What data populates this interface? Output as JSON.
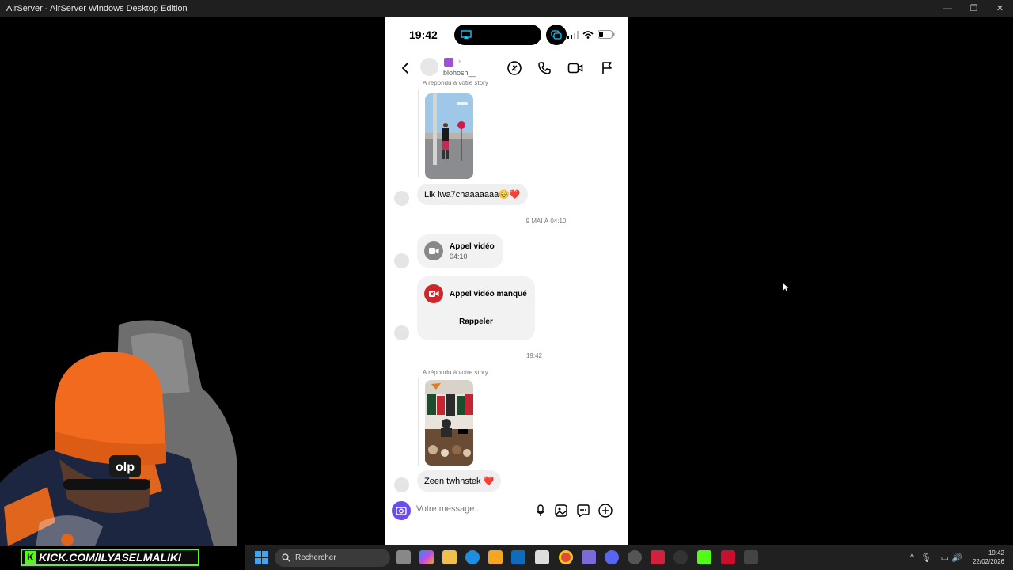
{
  "window": {
    "title": "AirServer - AirServer Windows Desktop Edition"
  },
  "phone": {
    "status": {
      "time": "19:42"
    },
    "header": {
      "username": "blohosh__"
    },
    "messages": {
      "top_partial_label": "A répondu à votre story",
      "reply1_text": "Lik lwa7chaaaaaaa🥺❤️",
      "timestamp1": "9 MAI À 04:10",
      "call1_title": "Appel vidéo",
      "call1_time": "04:10",
      "call2_title": "Appel vidéo manqué",
      "call2_action": "Rappeler",
      "timestamp2": "19:42",
      "replied_label": "A répondu à votre story",
      "reply2_text": "Zeen twhhstek ❤️"
    },
    "composer": {
      "placeholder": "Votre message..."
    }
  },
  "overlay": {
    "kick_text": "KICK.COM/ILYASELMALIKI",
    "kick_badge": "K"
  },
  "taskbar": {
    "search_label": "Rechercher",
    "clock_time": "19:42",
    "clock_date": "22/02/2026"
  }
}
